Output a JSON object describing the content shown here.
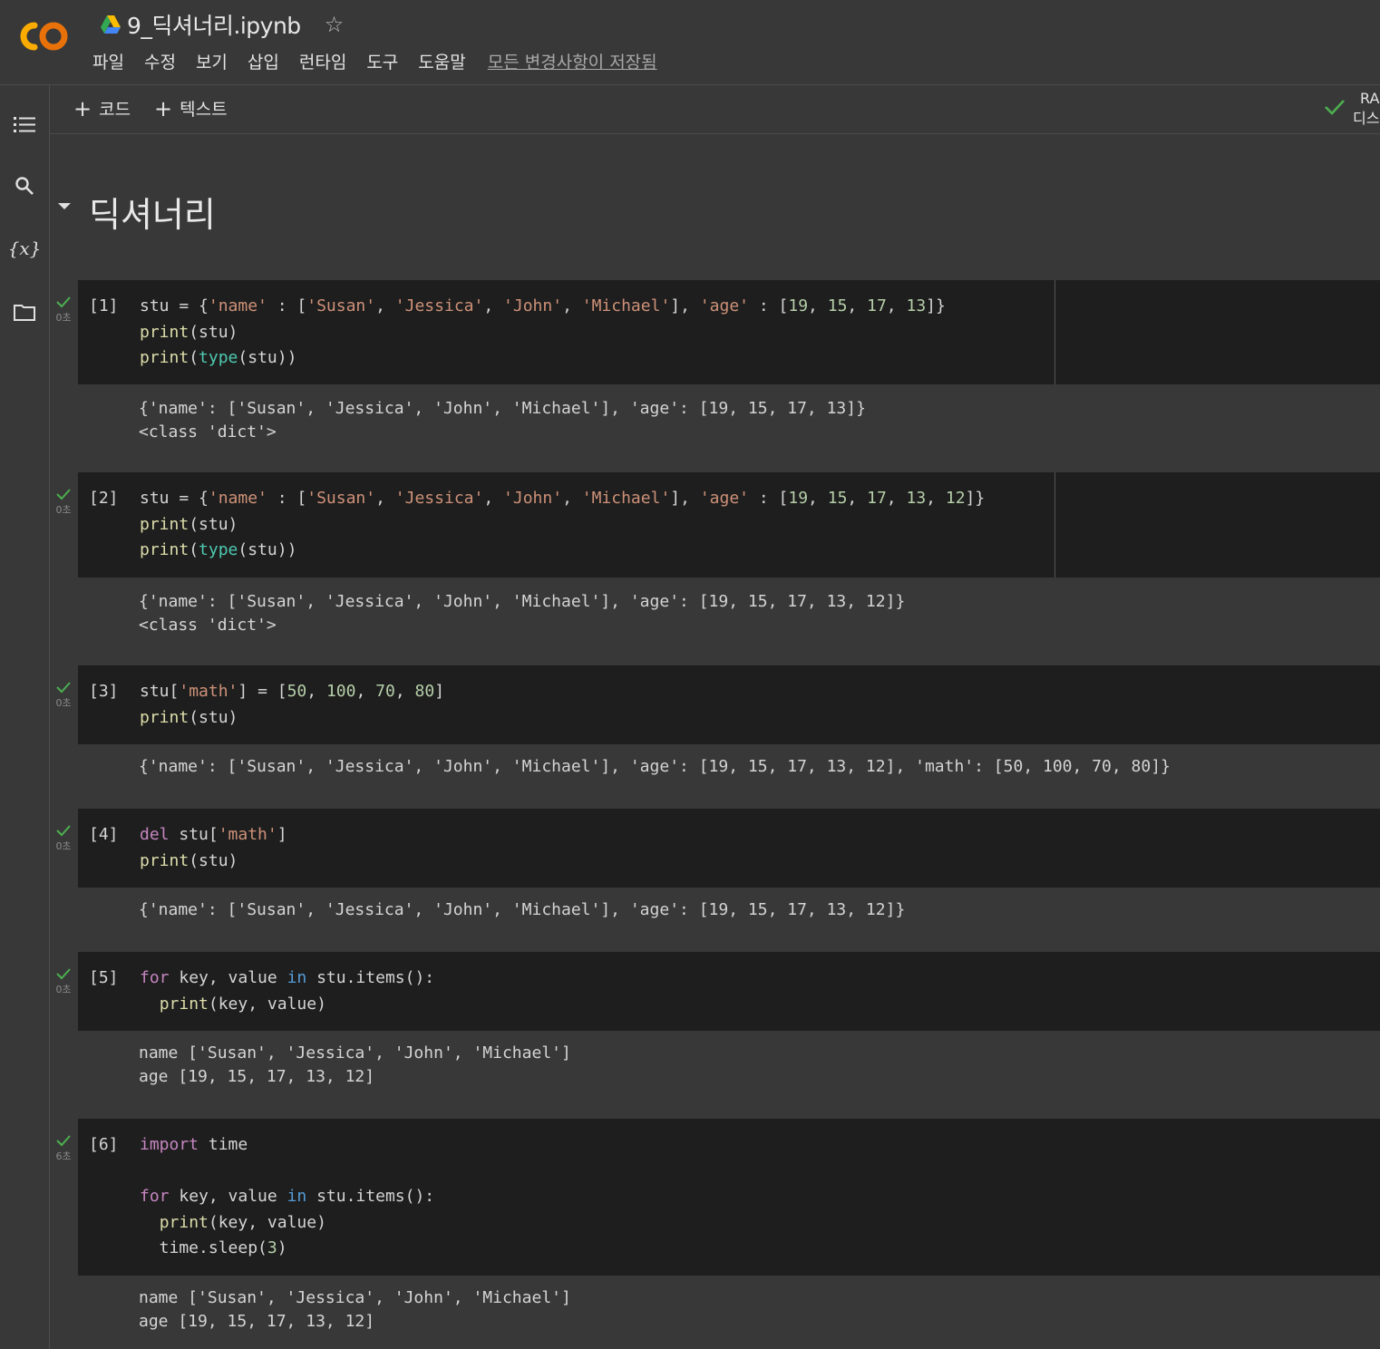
{
  "header": {
    "notebook_title": "9_딕셔너리.ipynb",
    "menu": [
      "파일",
      "수정",
      "보기",
      "삽입",
      "런타임",
      "도구",
      "도움말"
    ],
    "save_status": "모든 변경사항이 저장됨"
  },
  "toolbar": {
    "add_code": "코드",
    "add_text": "텍스트",
    "ram_label": "RA",
    "disk_label": "디스"
  },
  "section": {
    "title": "딕셔너리"
  },
  "cells": [
    {
      "exec": "[1]",
      "time": "0초",
      "code": [
        "stu = {'name' : ['Susan', 'Jessica', 'John', 'Michael'], 'age' : [19, 15, 17, 13]}",
        "print(stu)",
        "print(type(stu))"
      ],
      "output": [
        "{'name': ['Susan', 'Jessica', 'John', 'Michael'], 'age': [19, 15, 17, 13]}",
        "<class 'dict'>"
      ]
    },
    {
      "exec": "[2]",
      "time": "0초",
      "code": [
        "stu = {'name' : ['Susan', 'Jessica', 'John', 'Michael'], 'age' : [19, 15, 17, 13, 12]}",
        "print(stu)",
        "print(type(stu))"
      ],
      "output": [
        "{'name': ['Susan', 'Jessica', 'John', 'Michael'], 'age': [19, 15, 17, 13, 12]}",
        "<class 'dict'>"
      ]
    },
    {
      "exec": "[3]",
      "time": "0초",
      "code": [
        "stu['math'] = [50, 100, 70, 80]",
        "print(stu)"
      ],
      "output": [
        "{'name': ['Susan', 'Jessica', 'John', 'Michael'], 'age': [19, 15, 17, 13, 12], 'math': [50, 100, 70, 80]}"
      ]
    },
    {
      "exec": "[4]",
      "time": "0초",
      "code": [
        "del stu['math']",
        "print(stu)"
      ],
      "output": [
        "{'name': ['Susan', 'Jessica', 'John', 'Michael'], 'age': [19, 15, 17, 13, 12]}"
      ]
    },
    {
      "exec": "[5]",
      "time": "0초",
      "code": [
        "for key, value in stu.items():",
        "  print(key, value)"
      ],
      "output": [
        "name ['Susan', 'Jessica', 'John', 'Michael']",
        "age [19, 15, 17, 13, 12]"
      ]
    },
    {
      "exec": "[6]",
      "time": "6초",
      "code": [
        "import time",
        "",
        "for key, value in stu.items():",
        "  print(key, value)",
        "  time.sleep(3)"
      ],
      "output": [
        "name ['Susan', 'Jessica', 'John', 'Michael']",
        "age [19, 15, 17, 13, 12]"
      ]
    }
  ],
  "colors": {
    "background": "#383838",
    "code_background": "#1e1e1e",
    "string": "#ce9178",
    "number": "#b5cea8",
    "function": "#dcdcaa",
    "builtin_type": "#4ec9b0",
    "keyword_purple": "#c586c0",
    "keyword_blue": "#569cd6",
    "success_check": "#4caf50"
  },
  "icons": {
    "sidebar": [
      "toc-icon",
      "search-icon",
      "variables-icon",
      "folder-icon"
    ]
  }
}
